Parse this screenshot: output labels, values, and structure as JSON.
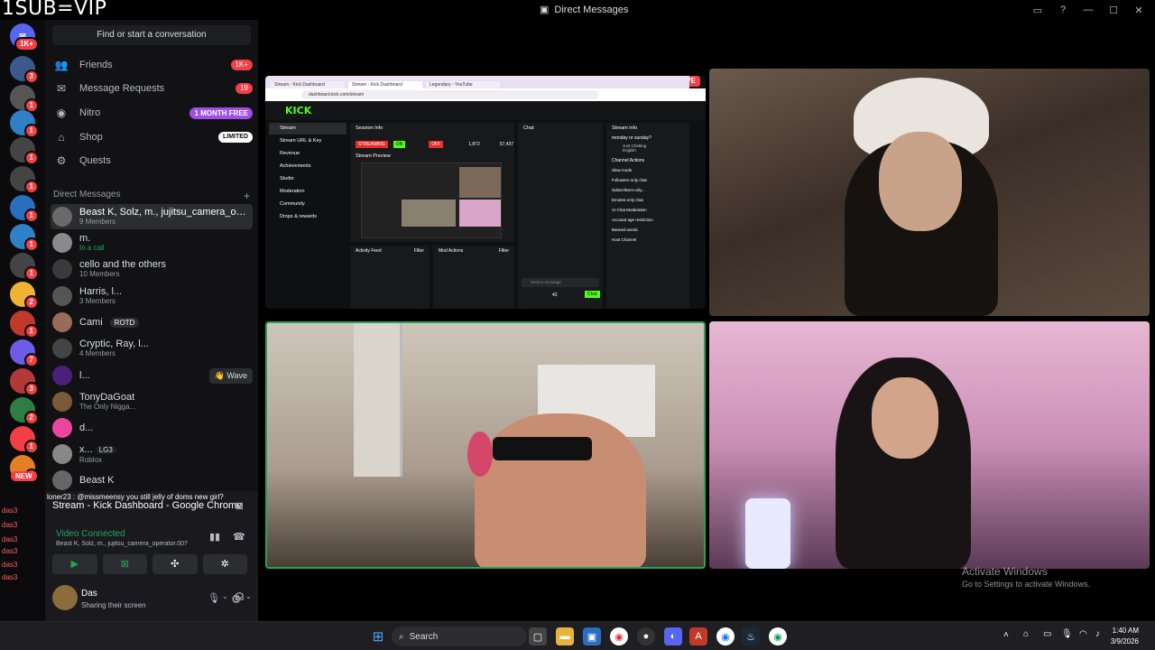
{
  "overlay_title": "1SUB=VIP",
  "window": {
    "title": "Direct Messages"
  },
  "rail_badges": [
    "1K+",
    "3",
    "1",
    "1",
    "1",
    "1",
    "1",
    "1",
    "1",
    "2",
    "1",
    "7",
    "3",
    "2",
    "1",
    "1"
  ],
  "sidebar": {
    "find_label": "Find or start a conversation",
    "nav": [
      {
        "label": "Friends",
        "badge": "1K+",
        "icon": "friends-icon"
      },
      {
        "label": "Message Requests",
        "badge": "19",
        "icon": "mail-icon"
      },
      {
        "label": "Nitro",
        "badge": "1 MONTH FREE",
        "icon": "nitro-icon"
      },
      {
        "label": "Shop",
        "badge": "LIMITED",
        "icon": "shop-icon"
      },
      {
        "label": "Quests",
        "badge": "",
        "icon": "quests-icon"
      }
    ],
    "dm_header": "Direct Messages",
    "dms": [
      {
        "name": "Beast K, Solz, m., jujitsu_camera_opera...",
        "sub": "9 Members",
        "active": true
      },
      {
        "name": "m.",
        "sub": "In a call"
      },
      {
        "name": "cello and the others",
        "sub": "10 Members"
      },
      {
        "name": "Harris, l...",
        "sub": "3 Members"
      },
      {
        "name": "Cami",
        "sub": "",
        "tag": "ROTD"
      },
      {
        "name": "Cryptic, Ray, l...",
        "sub": "4 Members"
      },
      {
        "name": "l...",
        "sub": "",
        "wave": "Wave"
      },
      {
        "name": "TonyDaGoat",
        "sub": "The Only Nigga..."
      },
      {
        "name": "d...",
        "sub": ""
      },
      {
        "name": "x...",
        "sub": "Roblox",
        "tag": "LG3"
      },
      {
        "name": "Beast K",
        "sub": ""
      }
    ]
  },
  "voice_panel": {
    "chat_line": "loner23 : @missmeensy you still jelly of doms new girl?",
    "stream_title": "Stream - Kick Dashboard - Google Chrome",
    "status": "Video Connected",
    "channel": "Beast K, Solz, m., jujitsu_camera_operator.007",
    "new_badge": "NEW",
    "user": {
      "name": "Das",
      "status": "Sharing their screen"
    },
    "overlay_names": [
      "das3",
      "das3",
      "das3",
      "das3",
      "das3",
      "das3",
      "qvixkso",
      "das3"
    ]
  },
  "stage": {
    "live_badge": "LIVE",
    "kick": {
      "url": "dashboard.kick.com/stream",
      "tabs": [
        "Stream - Kick Dashboard",
        "Stream - Kick Dashboard",
        "Legendary - YouTube"
      ],
      "logo": "KICK",
      "menu": [
        "Stream",
        "Stream URL & Key",
        "Revenue",
        "Achievements",
        "Studio",
        "Moderation",
        "Community",
        "Drops & rewards"
      ],
      "session_info": "Session Info",
      "streaming": "STREAMING",
      "on": "ON",
      "off": "OFF",
      "viewers": "1,872",
      "followers": "57,437",
      "stream_preview": "Stream Preview",
      "chat_title": "Chat",
      "stream_info": "Stream info",
      "stream_title": "monday or sunday?",
      "category": "Just Chatting",
      "language": "English",
      "channel_actions": "Channel Actions",
      "actions": [
        "Slow mode",
        "Followers-only chat",
        "Subscribers-only...",
        "Emotes-only chat",
        "AI Chat Moderation",
        "Account age restriction",
        "Banned words",
        "Host Channel"
      ],
      "activity_feed": "Activity Feed",
      "mod_actions": "Mod Actions",
      "filter": "Filter",
      "send_placeholder": "Send a message",
      "chat_btn": "Chat",
      "count": "42"
    }
  },
  "activate": {
    "line1": "Activate Windows",
    "line2": "Go to Settings to activate Windows."
  },
  "taskbar": {
    "search": "Search",
    "time": "1:40 AM",
    "date": "3/9/2026"
  }
}
